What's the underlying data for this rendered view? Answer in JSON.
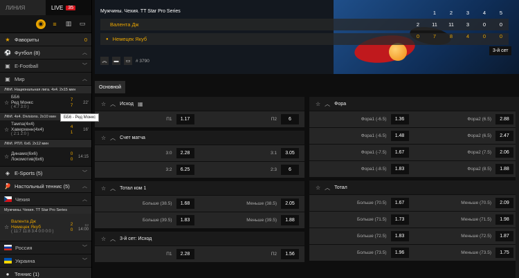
{
  "sidebar": {
    "tabs": {
      "line": "ЛИНИЯ",
      "live": "LIVE",
      "live_count": "35"
    },
    "favorites": {
      "label": "Фавориты",
      "count": "0"
    },
    "football": {
      "label": "Футбол (8)"
    },
    "efootball": {
      "label": "E-Football"
    },
    "world": {
      "label": "Мир"
    },
    "leagues": [
      {
        "title": "ЛФИ. Национальная лига. 4х4. 2х15 мин"
      },
      {
        "title": "ЛФИ. 4х4. Divisions. 2х10 мин"
      },
      {
        "title": "ЛФИ. РПЛ. 6х6. 2х12 мин"
      }
    ],
    "matches": [
      {
        "team1": "ББ6",
        "team2": "Ред Монкс",
        "sub": "( 4:7  3:0 )",
        "s1": "7",
        "s2": "7",
        "time": "22'"
      },
      {
        "team1": "Тампа(4х4)",
        "team2": "Хаверхенн(4х4)",
        "sub": "( 2:1  2:0 )",
        "s1": "4",
        "s2": "1",
        "time": "16'"
      },
      {
        "team1": "Динамо(6х6)",
        "team2": "Локомотив(6х6)",
        "sub": "",
        "s1": "0",
        "s2": "0",
        "time": "14:15"
      }
    ],
    "tooltip": "ББ6 - Ред Монкс",
    "esports": {
      "label": "E-Sports (5)"
    },
    "table_tennis": {
      "label": "Настольный теннис (5)"
    },
    "czech": {
      "label": "Чехия"
    },
    "tt_league": {
      "title": "Мужчины. Чехия. TT Star Pro Series"
    },
    "tt_match": {
      "team1": "Валента Дж",
      "team2": "Немецек Якуб",
      "sub": "( 11:7  11:8  3:4  0:0  0:0 )",
      "s1": "2",
      "s2": "0",
      "time": "14:00"
    },
    "russia": {
      "label": "Россия"
    },
    "ukraine": {
      "label": "Украина"
    },
    "tennis": {
      "label": "Теннис (1)"
    }
  },
  "hero": {
    "title": "Мужчины. Чехия. TT Star Pro Series",
    "team1": "Валента Дж",
    "team2": "Немецек Якуб",
    "header_cols": [
      "1",
      "2",
      "3",
      "4",
      "5"
    ],
    "row1": [
      "2",
      "11",
      "11",
      "3",
      "0",
      "0"
    ],
    "row2": [
      "0",
      "7",
      "8",
      "4",
      "0",
      "0"
    ],
    "set_badge": "3-й сет",
    "match_id": "# 3790"
  },
  "subtab": "Основной",
  "markets_left": [
    {
      "title": "Исход",
      "rows": [
        [
          {
            "l": "П1",
            "v": "1.17"
          },
          {
            "l": "П2",
            "v": "6"
          }
        ]
      ]
    },
    {
      "title": "Счет матча",
      "rows": [
        [
          {
            "l": "3:0",
            "v": "2.28"
          },
          {
            "l": "3:1",
            "v": "3.05"
          }
        ],
        [
          {
            "l": "3:2",
            "v": "6.25"
          },
          {
            "l": "2:3",
            "v": "6"
          }
        ]
      ]
    },
    {
      "title": "Тотал ком 1",
      "rows": [
        [
          {
            "l": "Больше (38.5)",
            "v": "1.68"
          },
          {
            "l": "Меньше (38.5)",
            "v": "2.05"
          }
        ],
        [
          {
            "l": "Больше (39.5)",
            "v": "1.83"
          },
          {
            "l": "Меньше (39.5)",
            "v": "1.88"
          }
        ]
      ]
    },
    {
      "title": "3-й сет: Исход",
      "rows": [
        [
          {
            "l": "П1",
            "v": "2.28"
          },
          {
            "l": "П2",
            "v": "1.56"
          }
        ]
      ]
    }
  ],
  "markets_right": [
    {
      "title": "Фора",
      "rows": [
        [
          {
            "l": "Фора1 (-6.5)",
            "v": "1.36"
          },
          {
            "l": "Фора2 (6.5)",
            "v": "2.88"
          }
        ],
        [
          {
            "l": "Фора1 (-6.5)",
            "v": "1.48"
          },
          {
            "l": "Фора2 (6.5)",
            "v": "2.47"
          }
        ],
        [
          {
            "l": "Фора1 (-7.5)",
            "v": "1.67"
          },
          {
            "l": "Фора2 (7.5)",
            "v": "2.06"
          }
        ],
        [
          {
            "l": "Фора1 (-8.5)",
            "v": "1.83"
          },
          {
            "l": "Фора2 (8.5)",
            "v": "1.88"
          }
        ]
      ]
    },
    {
      "title": "Тотал",
      "rows": [
        [
          {
            "l": "Больше (70.5)",
            "v": "1.67"
          },
          {
            "l": "Меньше (70.5)",
            "v": "2.09"
          }
        ],
        [
          {
            "l": "Больше (71.5)",
            "v": "1.73"
          },
          {
            "l": "Меньше (71.5)",
            "v": "1.98"
          }
        ],
        [
          {
            "l": "Больше (72.5)",
            "v": "1.83"
          },
          {
            "l": "Меньше (72.5)",
            "v": "1.87"
          }
        ],
        [
          {
            "l": "Больше (73.5)",
            "v": "1.96"
          },
          {
            "l": "Меньше (73.5)",
            "v": "1.75"
          }
        ]
      ]
    }
  ]
}
